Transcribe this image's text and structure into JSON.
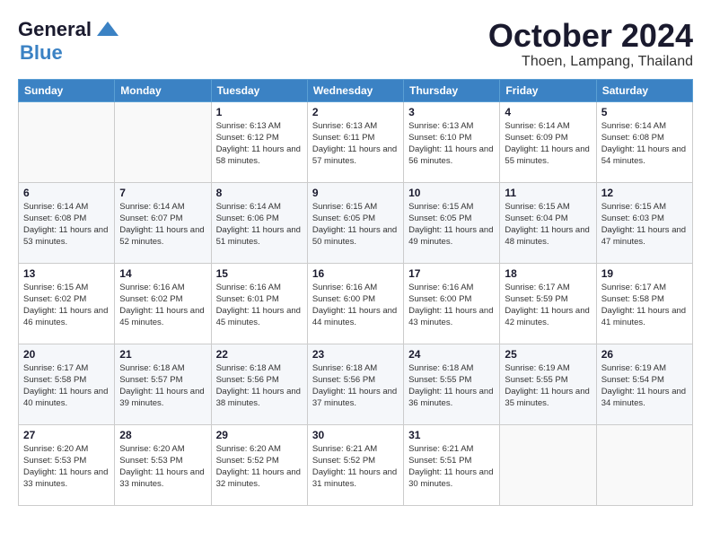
{
  "logo": {
    "text1": "General",
    "text2": "Blue"
  },
  "title": {
    "month": "October 2024",
    "location": "Thoen, Lampang, Thailand"
  },
  "weekdays": [
    "Sunday",
    "Monday",
    "Tuesday",
    "Wednesday",
    "Thursday",
    "Friday",
    "Saturday"
  ],
  "weeks": [
    [
      {
        "day": "",
        "info": ""
      },
      {
        "day": "",
        "info": ""
      },
      {
        "day": "1",
        "sunrise": "6:13 AM",
        "sunset": "6:12 PM",
        "daylight": "11 hours and 58 minutes."
      },
      {
        "day": "2",
        "sunrise": "6:13 AM",
        "sunset": "6:11 PM",
        "daylight": "11 hours and 57 minutes."
      },
      {
        "day": "3",
        "sunrise": "6:13 AM",
        "sunset": "6:10 PM",
        "daylight": "11 hours and 56 minutes."
      },
      {
        "day": "4",
        "sunrise": "6:14 AM",
        "sunset": "6:09 PM",
        "daylight": "11 hours and 55 minutes."
      },
      {
        "day": "5",
        "sunrise": "6:14 AM",
        "sunset": "6:08 PM",
        "daylight": "11 hours and 54 minutes."
      }
    ],
    [
      {
        "day": "6",
        "sunrise": "6:14 AM",
        "sunset": "6:08 PM",
        "daylight": "11 hours and 53 minutes."
      },
      {
        "day": "7",
        "sunrise": "6:14 AM",
        "sunset": "6:07 PM",
        "daylight": "11 hours and 52 minutes."
      },
      {
        "day": "8",
        "sunrise": "6:14 AM",
        "sunset": "6:06 PM",
        "daylight": "11 hours and 51 minutes."
      },
      {
        "day": "9",
        "sunrise": "6:15 AM",
        "sunset": "6:05 PM",
        "daylight": "11 hours and 50 minutes."
      },
      {
        "day": "10",
        "sunrise": "6:15 AM",
        "sunset": "6:05 PM",
        "daylight": "11 hours and 49 minutes."
      },
      {
        "day": "11",
        "sunrise": "6:15 AM",
        "sunset": "6:04 PM",
        "daylight": "11 hours and 48 minutes."
      },
      {
        "day": "12",
        "sunrise": "6:15 AM",
        "sunset": "6:03 PM",
        "daylight": "11 hours and 47 minutes."
      }
    ],
    [
      {
        "day": "13",
        "sunrise": "6:15 AM",
        "sunset": "6:02 PM",
        "daylight": "11 hours and 46 minutes."
      },
      {
        "day": "14",
        "sunrise": "6:16 AM",
        "sunset": "6:02 PM",
        "daylight": "11 hours and 45 minutes."
      },
      {
        "day": "15",
        "sunrise": "6:16 AM",
        "sunset": "6:01 PM",
        "daylight": "11 hours and 45 minutes."
      },
      {
        "day": "16",
        "sunrise": "6:16 AM",
        "sunset": "6:00 PM",
        "daylight": "11 hours and 44 minutes."
      },
      {
        "day": "17",
        "sunrise": "6:16 AM",
        "sunset": "6:00 PM",
        "daylight": "11 hours and 43 minutes."
      },
      {
        "day": "18",
        "sunrise": "6:17 AM",
        "sunset": "5:59 PM",
        "daylight": "11 hours and 42 minutes."
      },
      {
        "day": "19",
        "sunrise": "6:17 AM",
        "sunset": "5:58 PM",
        "daylight": "11 hours and 41 minutes."
      }
    ],
    [
      {
        "day": "20",
        "sunrise": "6:17 AM",
        "sunset": "5:58 PM",
        "daylight": "11 hours and 40 minutes."
      },
      {
        "day": "21",
        "sunrise": "6:18 AM",
        "sunset": "5:57 PM",
        "daylight": "11 hours and 39 minutes."
      },
      {
        "day": "22",
        "sunrise": "6:18 AM",
        "sunset": "5:56 PM",
        "daylight": "11 hours and 38 minutes."
      },
      {
        "day": "23",
        "sunrise": "6:18 AM",
        "sunset": "5:56 PM",
        "daylight": "11 hours and 37 minutes."
      },
      {
        "day": "24",
        "sunrise": "6:18 AM",
        "sunset": "5:55 PM",
        "daylight": "11 hours and 36 minutes."
      },
      {
        "day": "25",
        "sunrise": "6:19 AM",
        "sunset": "5:55 PM",
        "daylight": "11 hours and 35 minutes."
      },
      {
        "day": "26",
        "sunrise": "6:19 AM",
        "sunset": "5:54 PM",
        "daylight": "11 hours and 34 minutes."
      }
    ],
    [
      {
        "day": "27",
        "sunrise": "6:20 AM",
        "sunset": "5:53 PM",
        "daylight": "11 hours and 33 minutes."
      },
      {
        "day": "28",
        "sunrise": "6:20 AM",
        "sunset": "5:53 PM",
        "daylight": "11 hours and 33 minutes."
      },
      {
        "day": "29",
        "sunrise": "6:20 AM",
        "sunset": "5:52 PM",
        "daylight": "11 hours and 32 minutes."
      },
      {
        "day": "30",
        "sunrise": "6:21 AM",
        "sunset": "5:52 PM",
        "daylight": "11 hours and 31 minutes."
      },
      {
        "day": "31",
        "sunrise": "6:21 AM",
        "sunset": "5:51 PM",
        "daylight": "11 hours and 30 minutes."
      },
      {
        "day": "",
        "info": ""
      },
      {
        "day": "",
        "info": ""
      }
    ]
  ]
}
